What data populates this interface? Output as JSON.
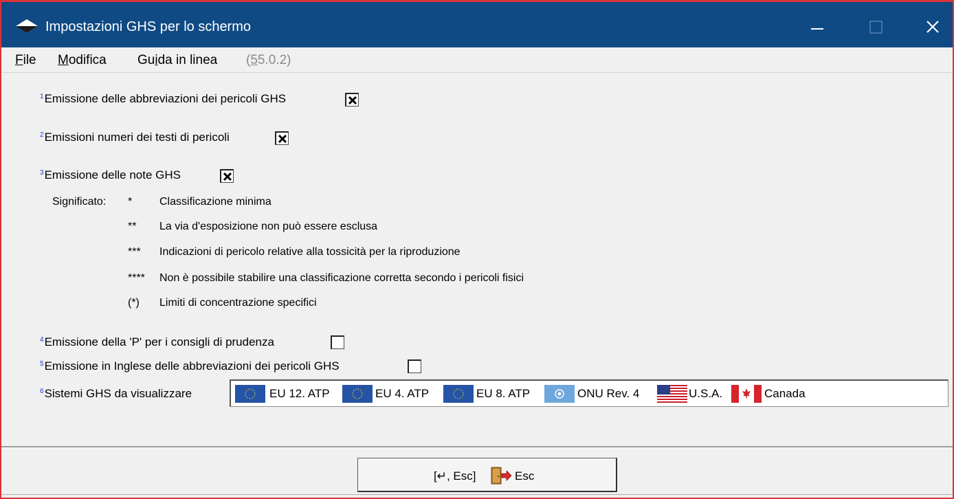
{
  "window": {
    "title": "Impostazioni GHS per lo schermo"
  },
  "menu": {
    "file": "File",
    "modifica": "Modifica",
    "guida": "Guida in linea",
    "version": "(55.0.2)"
  },
  "options": [
    {
      "num": "1",
      "label": "Emissione delle abbreviazioni dei pericoli GHS",
      "checked": true
    },
    {
      "num": "2",
      "label": "Emissioni numeri dei testi di pericoli",
      "checked": true
    },
    {
      "num": "3",
      "label": "Emissione delle note GHS",
      "checked": true
    },
    {
      "num": "4",
      "label": "Emissione della 'P' per i consigli di prudenza",
      "checked": false
    },
    {
      "num": "5",
      "label": "Emissione in Inglese delle abbreviazioni dei pericoli GHS",
      "checked": false
    }
  ],
  "meaning": {
    "label": "Significato:",
    "rows": [
      {
        "symbol": "*",
        "text": "Classificazione minima"
      },
      {
        "symbol": "**",
        "text": "La via d'esposizione non può essere esclusa"
      },
      {
        "symbol": "***",
        "text": "Indicazioni di pericolo relative alla tossicità per la riproduzione"
      },
      {
        "symbol": "****",
        "text": "Non è possibile stabilire una classificazione corretta secondo i pericoli fisici"
      },
      {
        "symbol": "(*)",
        "text": "Limiti di concentrazione specifici"
      }
    ]
  },
  "ghs_systems": {
    "num": "6",
    "label": "Sistemi GHS da visualizzare",
    "items": [
      {
        "flag": "eu-flag-icon",
        "label": "EU 12. ATP"
      },
      {
        "flag": "eu-flag-icon",
        "label": "EU 4. ATP"
      },
      {
        "flag": "eu-flag-icon",
        "label": "EU 8. ATP"
      },
      {
        "flag": "un-flag-icon",
        "label": "ONU Rev. 4"
      },
      {
        "flag": "usa-flag-icon",
        "label": "U.S.A."
      },
      {
        "flag": "canada-flag-icon",
        "label": "Canada"
      }
    ]
  },
  "footer": {
    "esc_prefix": "[↵, Esc]",
    "esc_label": "Esc"
  },
  "colors": {
    "titlebar": "#0f4a85",
    "border": "#d9343b",
    "superscript": "#1f3fd0"
  }
}
